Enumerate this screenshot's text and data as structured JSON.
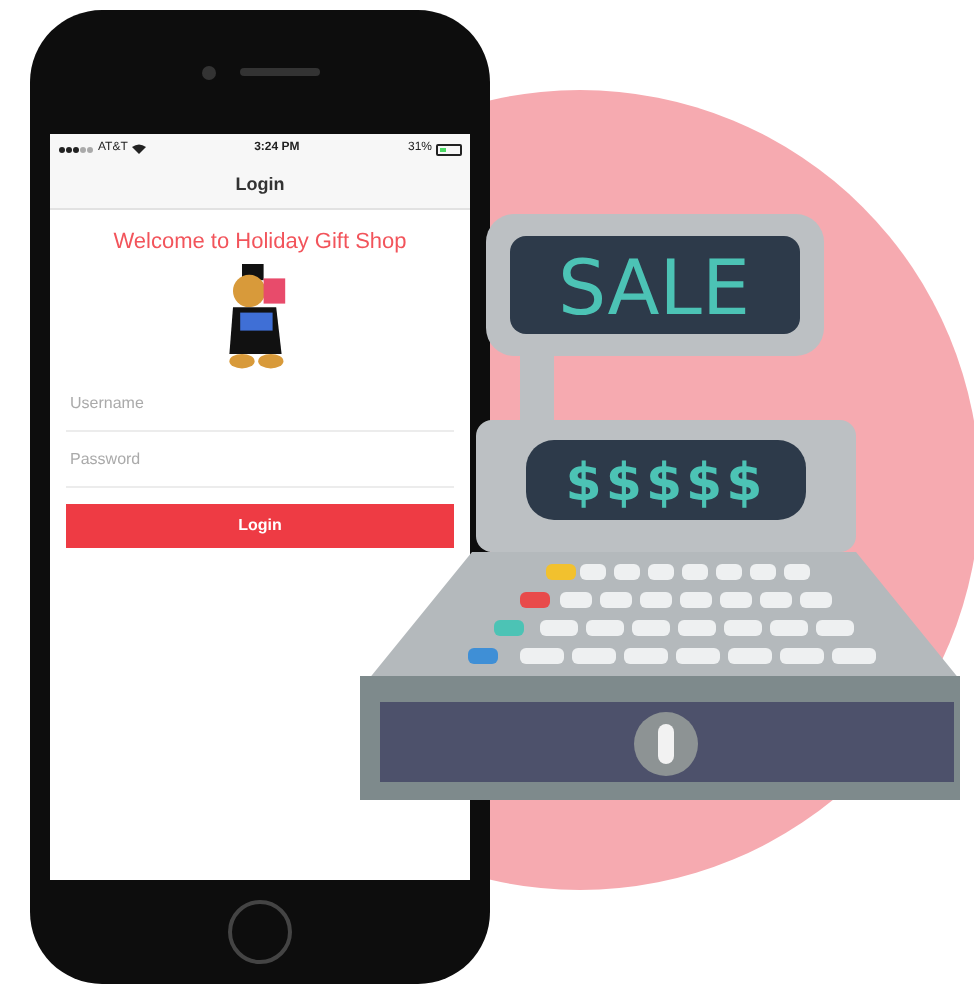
{
  "status_bar": {
    "carrier": "AT&T",
    "time": "3:24 PM",
    "battery": "31%"
  },
  "nav_bar": {
    "title": "Login"
  },
  "welcome": "Welcome to Holiday Gift Shop",
  "form": {
    "fields": [
      {
        "placeholder": "Username"
      },
      {
        "placeholder": "Password"
      }
    ],
    "button": "Login"
  },
  "register": {
    "sign": "SALE",
    "display": "$$$$$"
  }
}
